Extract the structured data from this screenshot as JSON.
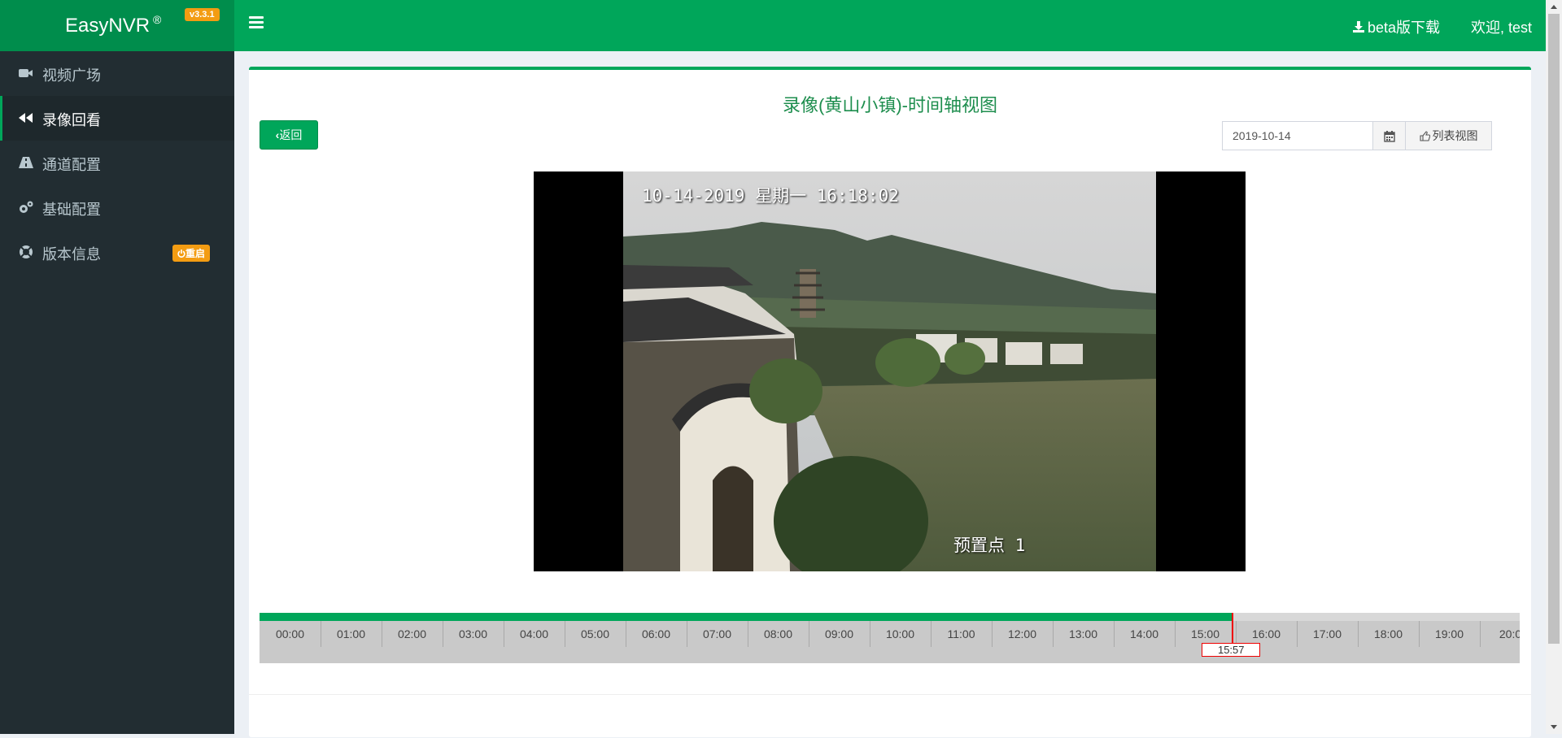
{
  "app": {
    "name": "EasyNVR",
    "reg_mark": "®",
    "version": "v3.3.1"
  },
  "header": {
    "beta_download": "beta版下载",
    "welcome": "欢迎, test"
  },
  "sidebar": {
    "items": [
      {
        "label": "视频广场",
        "icon": "video-camera-icon"
      },
      {
        "label": "录像回看",
        "icon": "backward-icon",
        "active": true
      },
      {
        "label": "通道配置",
        "icon": "road-icon"
      },
      {
        "label": "基础配置",
        "icon": "gears-icon"
      },
      {
        "label": "版本信息",
        "icon": "lifebuoy-icon",
        "badge": "重启"
      }
    ]
  },
  "main": {
    "title": "录像(黄山小镇)-时间轴视图",
    "back_label": "返回",
    "date_value": "2019-10-14",
    "list_view_label": "列表视图"
  },
  "video": {
    "osd_timestamp": "10-14-2019 星期一 16:18:02",
    "osd_preset": "预置点 1"
  },
  "timeline": {
    "hours": [
      "00:00",
      "01:00",
      "02:00",
      "03:00",
      "04:00",
      "05:00",
      "06:00",
      "07:00",
      "08:00",
      "09:00",
      "10:00",
      "11:00",
      "12:00",
      "13:00",
      "14:00",
      "15:00",
      "16:00",
      "17:00",
      "18:00",
      "19:00",
      "20:0"
    ],
    "recorded_until_hours": 15.95,
    "cursor_hours": 15.95,
    "cursor_label": "15:57",
    "colors": {
      "recorded": "#00a65a",
      "cursor": "#ee0000"
    }
  },
  "colors": {
    "brand": "#00a65a",
    "brand_dark": "#008d4c",
    "sidebar": "#222d32",
    "badge": "#f39c12"
  }
}
